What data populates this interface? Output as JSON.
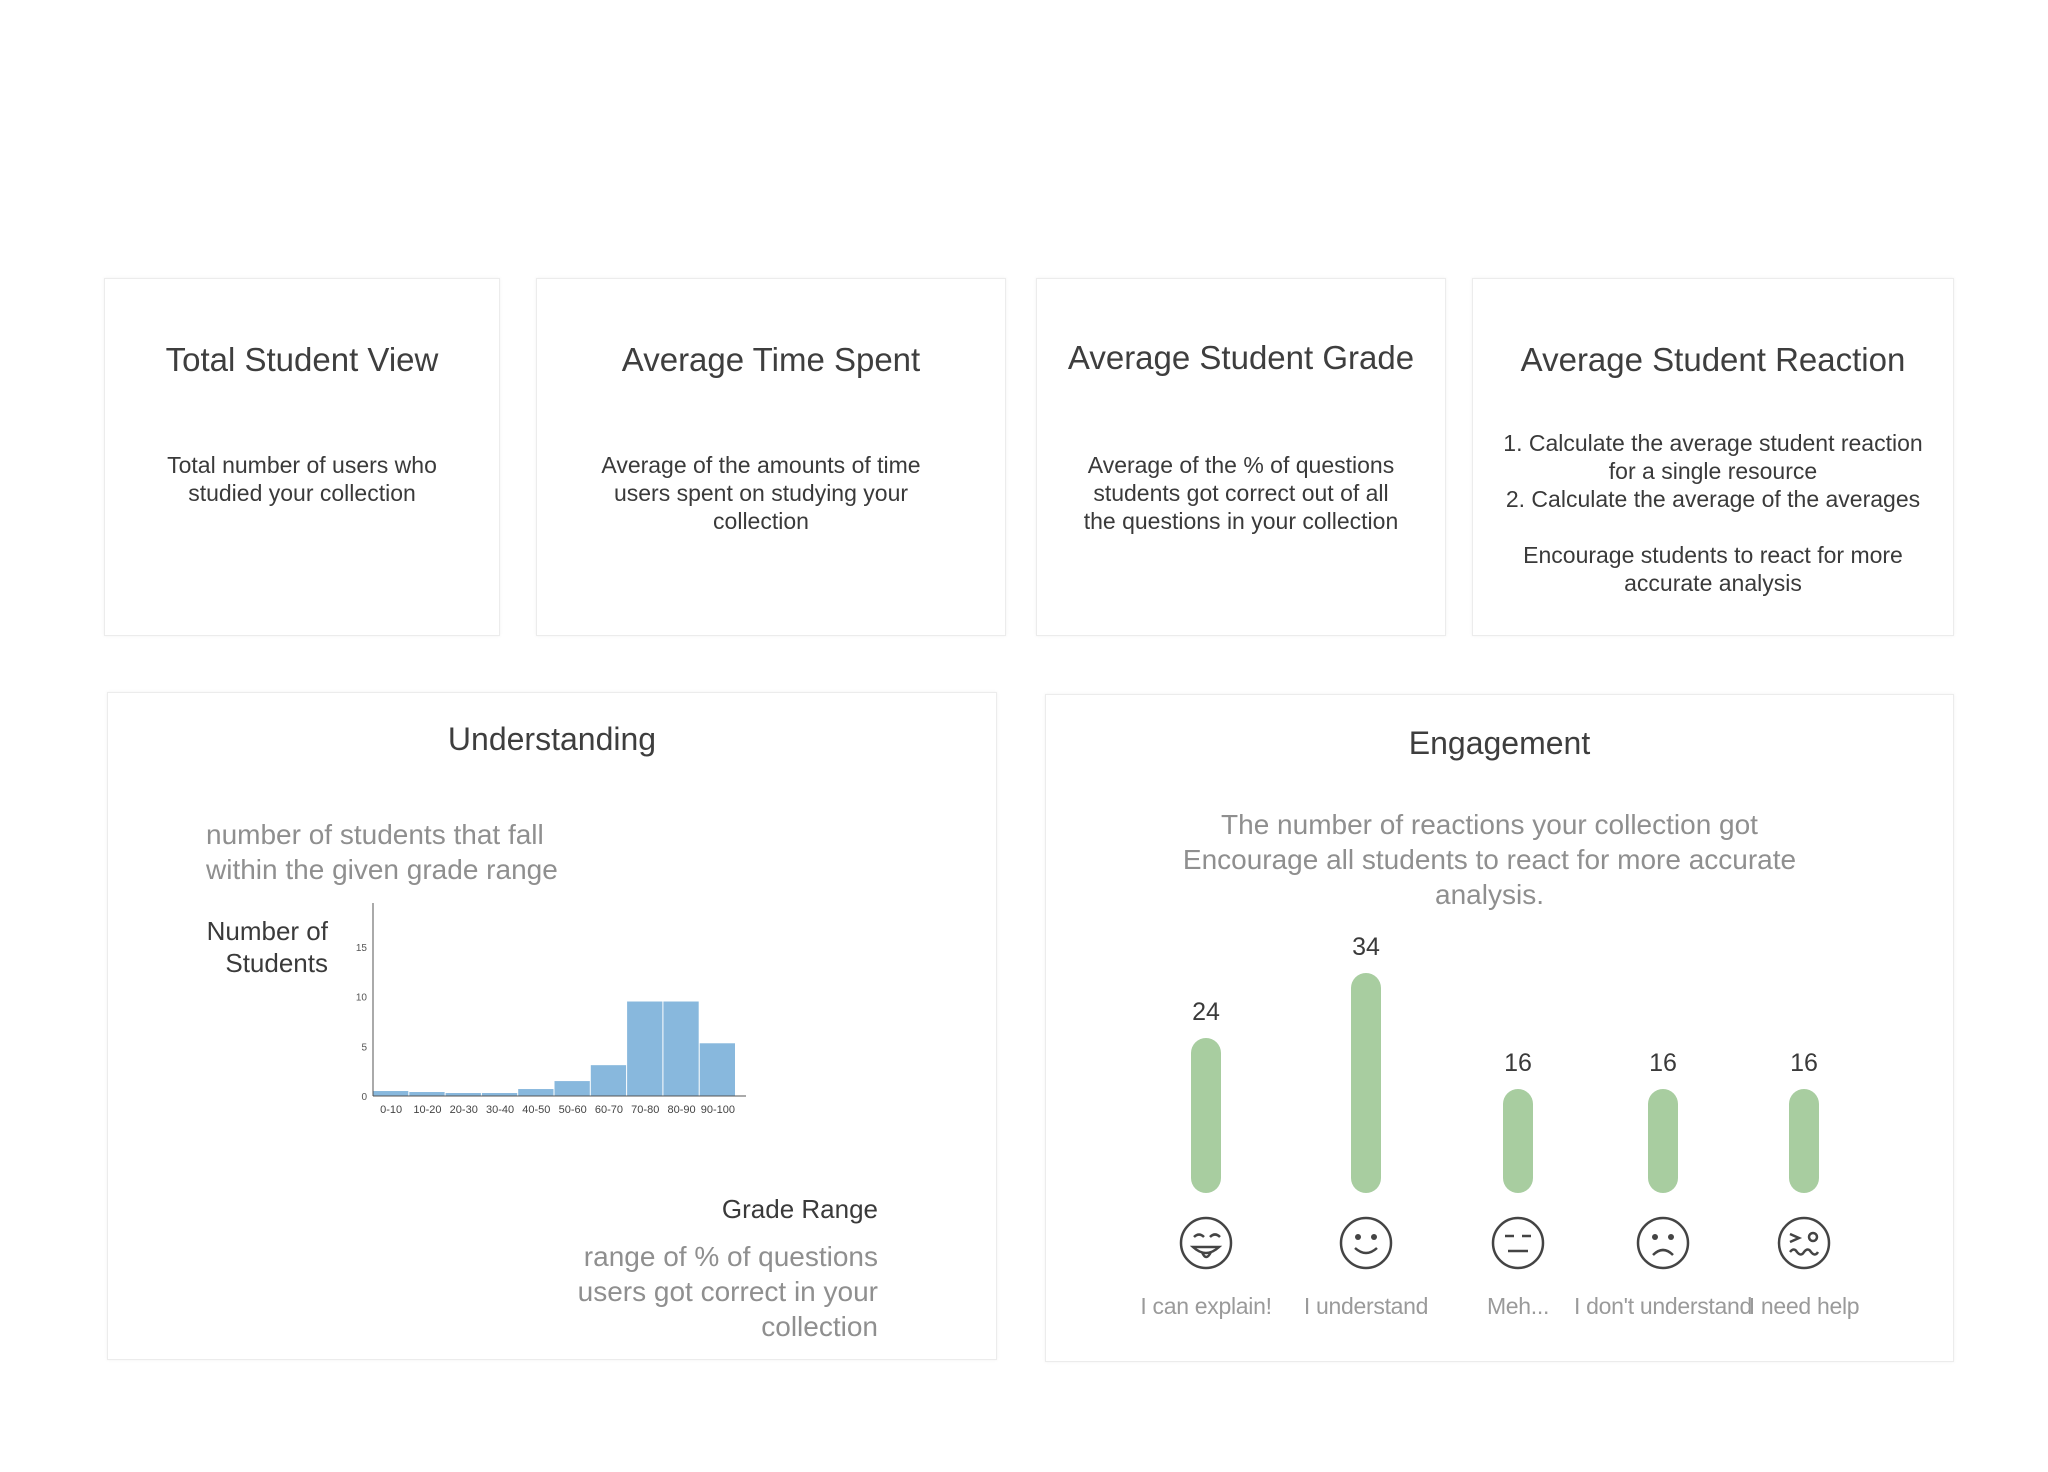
{
  "metrics": [
    {
      "title": "Total Student View",
      "description": "Total number of users who\nstudied your collection"
    },
    {
      "title": "Average Time Spent",
      "description": "Average of the amounts of time\nusers spent on studying your\ncollection"
    },
    {
      "title": "Average Student Grade",
      "description": "Average of the % of questions\nstudents got correct out of all\nthe questions in your collection"
    },
    {
      "title": "Average Student Reaction",
      "description": "1. Calculate the average student reaction\nfor a single resource\n2. Calculate the average of the averages\n\nEncourage students to react for more\naccurate analysis"
    }
  ],
  "understanding": {
    "title": "Understanding",
    "subtitle": "number of students that fall\nwithin the given grade range",
    "ylabel": "Number of\nStudents",
    "xlabel": "Grade Range",
    "xnote": "range of % of questions\nusers got correct in your\ncollection",
    "bar_color": "#88b8dd"
  },
  "engagement": {
    "title": "Engagement",
    "subtitle": "The number of reactions your collection got\nEncourage all students to react for more accurate\nanalysis.",
    "bar_color": "#a8cda0",
    "reactions": [
      {
        "label": "I can explain!",
        "value": 24,
        "value_text": "24",
        "icon": "tongue-wink-face-icon"
      },
      {
        "label": "I understand",
        "value": 34,
        "value_text": "34",
        "icon": "smile-face-icon"
      },
      {
        "label": "Meh...",
        "value": 16,
        "value_text": "16",
        "icon": "neutral-face-icon"
      },
      {
        "label": "I don't understand",
        "value": 16,
        "value_text": "16",
        "icon": "frown-face-icon"
      },
      {
        "label": "I need help",
        "value": 16,
        "value_text": "16",
        "icon": "dizzy-face-icon"
      }
    ]
  },
  "chart_data": {
    "type": "bar",
    "categories": [
      "0-10",
      "10-20",
      "20-30",
      "30-40",
      "40-50",
      "50-60",
      "60-70",
      "70-80",
      "80-90",
      "90-100"
    ],
    "values": [
      0.5,
      0.4,
      0.3,
      0.3,
      0.7,
      1.5,
      3.1,
      9.5,
      9.5,
      5.3
    ],
    "xlabel": "Grade Range",
    "ylabel": "Number of Students",
    "yticks": [
      0,
      5,
      10,
      15
    ],
    "ylim": [
      0,
      19
    ],
    "grid": false
  }
}
